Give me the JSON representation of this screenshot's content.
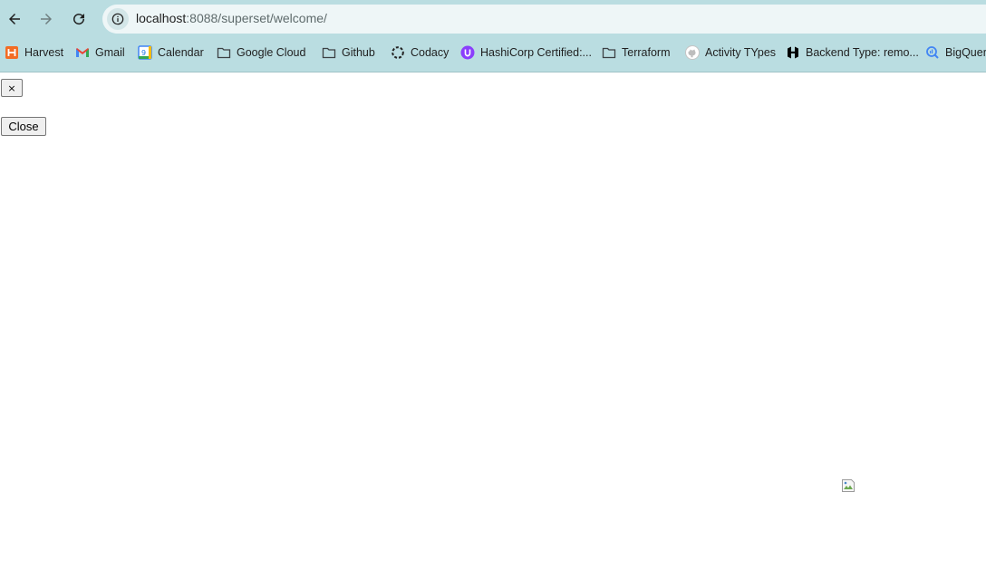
{
  "browser": {
    "url_host": "localhost",
    "url_path": ":8088/superset/welcome/"
  },
  "bookmarks": [
    {
      "label": "Harvest",
      "icon": "harvest-icon"
    },
    {
      "label": "Gmail",
      "icon": "gmail-icon"
    },
    {
      "label": "Calendar",
      "icon": "calendar-icon"
    },
    {
      "label": "Google Cloud",
      "icon": "folder-icon"
    },
    {
      "label": "Github",
      "icon": "folder-icon"
    },
    {
      "label": "Codacy",
      "icon": "codacy-icon"
    },
    {
      "label": "HashiCorp Certified:...",
      "icon": "hashicorp-badge-icon"
    },
    {
      "label": "Terraform",
      "icon": "folder-icon"
    },
    {
      "label": "Activity TYpes",
      "icon": "github-icon"
    },
    {
      "label": "Backend Type: remo...",
      "icon": "hashicorp-icon"
    },
    {
      "label": "BigQuery",
      "icon": "bigquery-icon"
    }
  ],
  "page": {
    "dismiss_label": "×",
    "close_label": "Close"
  },
  "colors": {
    "toolbar_bg": "#badde1",
    "omnibox_bg": "#eef6f7",
    "page_bg": "#ffffff"
  }
}
